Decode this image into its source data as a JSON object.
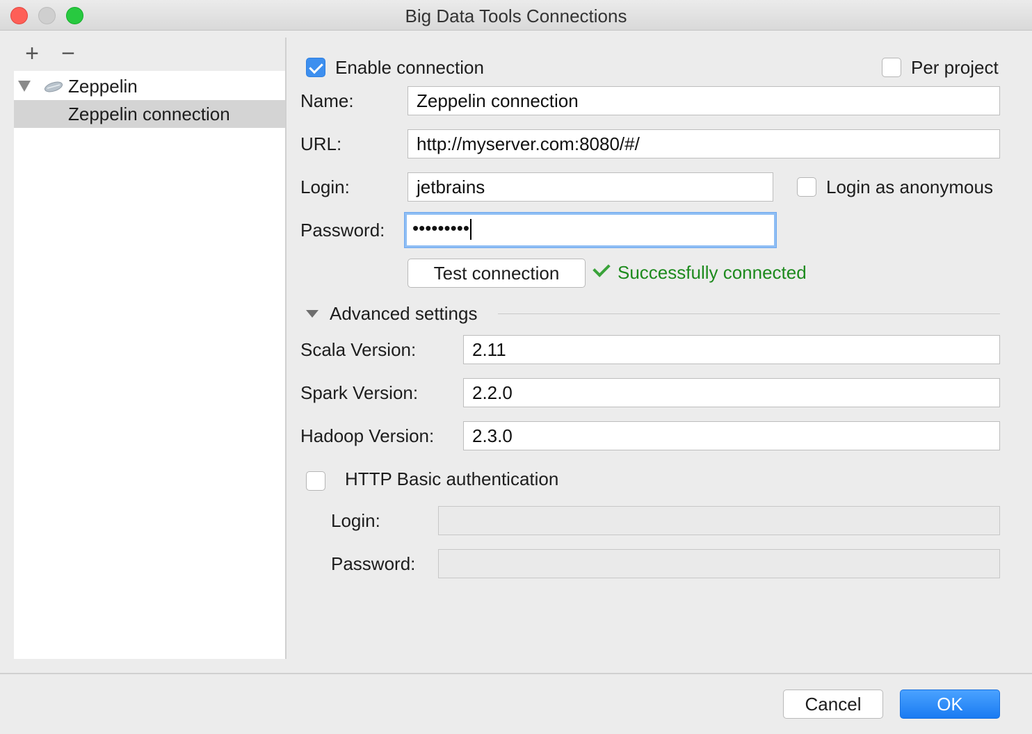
{
  "window": {
    "title": "Big Data Tools Connections"
  },
  "toolbar": {
    "add_label": "+",
    "remove_label": "−"
  },
  "tree": {
    "root_label": "Zeppelin",
    "child_label": "Zeppelin connection"
  },
  "form": {
    "enable_connection_label": "Enable connection",
    "enable_connection_checked": true,
    "per_project_label": "Per project",
    "per_project_checked": false,
    "name_label": "Name:",
    "name_value": "Zeppelin connection",
    "url_label": "URL:",
    "url_value": "http://myserver.com:8080/#/",
    "login_label": "Login:",
    "login_value": "jetbrains",
    "anonymous_label": "Login as anonymous",
    "anonymous_checked": false,
    "password_label": "Password:",
    "password_value": "•••••••••",
    "test_button_label": "Test connection",
    "status_text": "Successfully connected",
    "status_color": "#1d8a1d"
  },
  "advanced": {
    "header": "Advanced settings",
    "scala_label": "Scala Version:",
    "scala_value": "2.11",
    "spark_label": "Spark Version:",
    "spark_value": "2.2.0",
    "hadoop_label": "Hadoop Version:",
    "hadoop_value": "2.3.0",
    "http_auth_label": "HTTP Basic authentication",
    "http_auth_checked": false,
    "http_login_label": "Login:",
    "http_login_value": "",
    "http_password_label": "Password:",
    "http_password_value": ""
  },
  "footer": {
    "cancel_label": "Cancel",
    "ok_label": "OK"
  },
  "colors": {
    "accent": "#1a7bf2",
    "selection": "#d4d4d4"
  }
}
